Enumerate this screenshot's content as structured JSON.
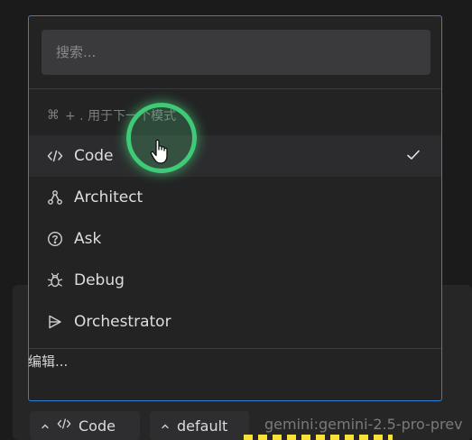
{
  "search": {
    "placeholder": "搜索..."
  },
  "hint": {
    "cmd_symbol": "⌘",
    "text": "+ . 用于下一个模式"
  },
  "modes": [
    {
      "label": "Code",
      "icon": "code-icon",
      "selected": true
    },
    {
      "label": "Architect",
      "icon": "architect-icon",
      "selected": false
    },
    {
      "label": "Ask",
      "icon": "question-circle-icon",
      "selected": false
    },
    {
      "label": "Debug",
      "icon": "bug-icon",
      "selected": false
    },
    {
      "label": "Orchestrator",
      "icon": "orchestrator-icon",
      "selected": false
    }
  ],
  "edit_label": "编辑...",
  "footer": {
    "mode_chip": {
      "label": "Code",
      "icon": "code-icon"
    },
    "profile_chip": {
      "label": "default"
    },
    "model_text": "gemini:gemini-2.5-pro-prev"
  },
  "colors": {
    "accent_border": "#2f7fd6",
    "cursor_highlight": "#3fca78"
  }
}
